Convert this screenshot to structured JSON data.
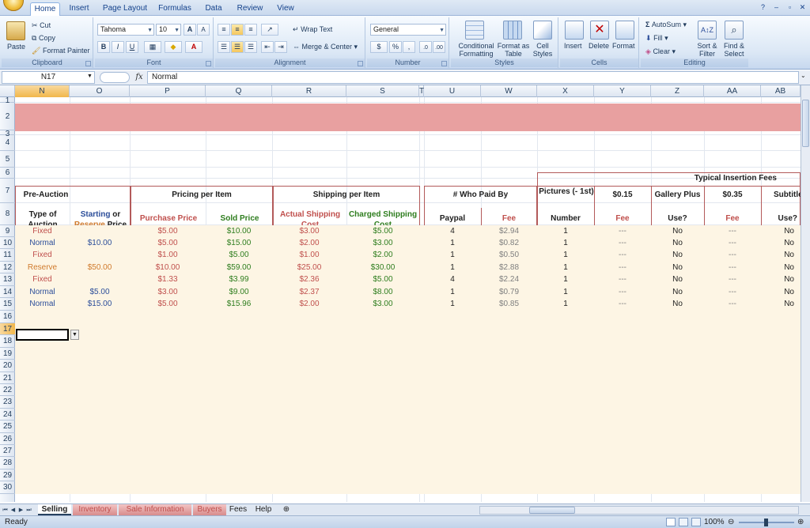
{
  "tabs": [
    "Home",
    "Insert",
    "Page Layout",
    "Formulas",
    "Data",
    "Review",
    "View"
  ],
  "ribbon": {
    "clipboard": {
      "paste": "Paste",
      "cut": "Cut",
      "copy": "Copy",
      "format_painter": "Format Painter",
      "label": "Clipboard"
    },
    "font": {
      "name": "Tahoma",
      "size": "10",
      "bold": "B",
      "italic": "I",
      "underline": "U",
      "grow": "A",
      "shrink": "A",
      "color": "A",
      "label": "Font"
    },
    "alignment": {
      "wrap_text": "Wrap Text",
      "merge_center": "Merge & Center",
      "label": "Alignment"
    },
    "number": {
      "format": "General",
      "currency": "$",
      "percent": "%",
      "comma": ",",
      "label": "Number"
    },
    "styles": {
      "conditional": "Conditional Formatting",
      "format_table": "Format as Table",
      "cell_styles": "Cell Styles",
      "label": "Styles"
    },
    "cells": {
      "insert": "Insert",
      "delete": "Delete",
      "format": "Format",
      "label": "Cells"
    },
    "editing": {
      "autosum": "AutoSum",
      "fill": "Fill",
      "clear": "Clear",
      "sort_filter": "Sort & Filter",
      "find_select": "Find & Select",
      "label": "Editing"
    }
  },
  "formula_bar": {
    "name_box": "N17",
    "fx": "fx",
    "formula": "Normal"
  },
  "columns": [
    "N",
    "O",
    "P",
    "Q",
    "R",
    "S",
    "T",
    "U",
    "W",
    "X",
    "Y",
    "Z",
    "AA",
    "AB"
  ],
  "rows": [
    "1",
    "2",
    "3",
    "4",
    "5",
    "6",
    "7",
    "8",
    "9",
    "10",
    "11",
    "12",
    "13",
    "14",
    "15",
    "16",
    "17",
    "18",
    "19",
    "20",
    "21",
    "22",
    "23",
    "24",
    "25",
    "26",
    "27",
    "28",
    "29",
    "30"
  ],
  "headers": {
    "pre_auction": "Pre-Auction",
    "type_of_auction": "Type of Auction",
    "starting": "Starting",
    "or": " or",
    "reserve": "Reserve",
    "price": " Price",
    "pricing_per_item": "Pricing per Item",
    "purchase_price": "Purchase Price",
    "sold_price": "Sold Price",
    "shipping_per_item": "Shipping per Item",
    "actual_shipping_cost": "Actual Shipping Cost",
    "charged_shipping_cost": "Charged Shipping Cost",
    "who_paid_by": "# Who Paid By",
    "paypal": "Paypal",
    "fee": "Fee",
    "typical_insertion_fees": "Typical Insertion Fees",
    "pictures": "Pictures (- 1st)",
    "number": "Number",
    "fee_015": "$0.15",
    "fee_col": "Fee",
    "gallery_plus": "Gallery Plus",
    "use": "Use?",
    "fee_035": "$0.35",
    "fee_col2": "Fee",
    "subtitle": "Subtitle",
    "use2": "Use?"
  },
  "data_rows": [
    {
      "type": "Fixed",
      "start": "",
      "purchase": "$5.00",
      "sold": "$10.00",
      "actual": "$3.00",
      "charged": "$5.00",
      "paypal": "4",
      "fee": "$2.94",
      "pictures": "1",
      "fee15": "---",
      "gallery": "No",
      "fee35": "---",
      "subtitle": "No"
    },
    {
      "type": "Normal",
      "start": "$10.00",
      "purchase": "$5.00",
      "sold": "$15.00",
      "actual": "$2.00",
      "charged": "$3.00",
      "paypal": "1",
      "fee": "$0.82",
      "pictures": "1",
      "fee15": "---",
      "gallery": "No",
      "fee35": "---",
      "subtitle": "No"
    },
    {
      "type": "Fixed",
      "start": "",
      "purchase": "$1.00",
      "sold": "$5.00",
      "actual": "$1.00",
      "charged": "$2.00",
      "paypal": "1",
      "fee": "$0.50",
      "pictures": "1",
      "fee15": "---",
      "gallery": "No",
      "fee35": "---",
      "subtitle": "No"
    },
    {
      "type": "Reserve",
      "start": "$50.00",
      "purchase": "$10.00",
      "sold": "$59.00",
      "actual": "$25.00",
      "charged": "$30.00",
      "paypal": "1",
      "fee": "$2.88",
      "pictures": "1",
      "fee15": "---",
      "gallery": "No",
      "fee35": "---",
      "subtitle": "No"
    },
    {
      "type": "Fixed",
      "start": "",
      "purchase": "$1.33",
      "sold": "$3.99",
      "actual": "$2.36",
      "charged": "$5.00",
      "paypal": "4",
      "fee": "$2.24",
      "pictures": "1",
      "fee15": "---",
      "gallery": "No",
      "fee35": "---",
      "subtitle": "No"
    },
    {
      "type": "Normal",
      "start": "$5.00",
      "purchase": "$3.00",
      "sold": "$9.00",
      "actual": "$2.37",
      "charged": "$8.00",
      "paypal": "1",
      "fee": "$0.79",
      "pictures": "1",
      "fee15": "---",
      "gallery": "No",
      "fee35": "---",
      "subtitle": "No"
    },
    {
      "type": "Normal",
      "start": "$15.00",
      "purchase": "$5.00",
      "sold": "$15.96",
      "actual": "$2.00",
      "charged": "$3.00",
      "paypal": "1",
      "fee": "$0.85",
      "pictures": "1",
      "fee15": "---",
      "gallery": "No",
      "fee35": "---",
      "subtitle": "No"
    }
  ],
  "sheet_tabs": [
    "Selling",
    "Inventory",
    "Sale Information",
    "Buyers",
    "Fees",
    "Help"
  ],
  "status": {
    "ready": "Ready",
    "zoom": "100%"
  },
  "colors": {
    "title_band": "#e8a0a0",
    "data_fill": "#fdf5e4",
    "border": "#b35a5a"
  }
}
